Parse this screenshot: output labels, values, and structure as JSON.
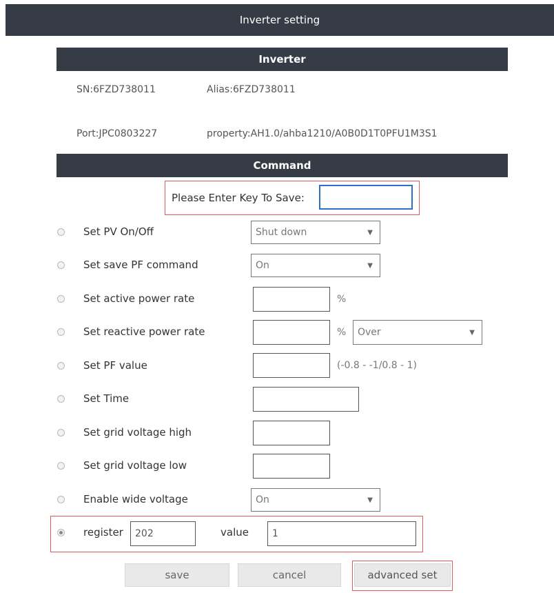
{
  "header": {
    "title": "Inverter setting"
  },
  "inverter_section": {
    "title": "Inverter"
  },
  "info": {
    "sn": "SN:6FZD738011",
    "alias": "Alias:6FZD738011",
    "port": "Port:JPC0803227",
    "property": "property:AH1.0/ahba1210/A0B0D1T0PFU1M3S1"
  },
  "command_section": {
    "title": "Command"
  },
  "key": {
    "label": "Please Enter Key To Save:",
    "value": ""
  },
  "commands": {
    "pv": {
      "label": "Set PV On/Off",
      "selected": "Shut down"
    },
    "save_pf": {
      "label": "Set save PF command",
      "selected": "On"
    },
    "active": {
      "label": "Set active power rate",
      "value": "",
      "unit": "%"
    },
    "reactive": {
      "label": "Set reactive power rate",
      "value": "",
      "unit": "%",
      "mode_selected": "Over"
    },
    "pf_value": {
      "label": "Set PF value",
      "value": "",
      "range": "(-0.8 - -1/0.8 - 1)"
    },
    "time": {
      "label": "Set Time",
      "value": ""
    },
    "grid_high": {
      "label": "Set grid voltage high",
      "value": ""
    },
    "grid_low": {
      "label": "Set grid voltage low",
      "value": ""
    },
    "wide": {
      "label": "Enable wide voltage",
      "selected": "On"
    },
    "register": {
      "label": "register",
      "register_value": "202",
      "value_label": "value",
      "value": "1"
    }
  },
  "buttons": {
    "save": "save",
    "cancel": "cancel",
    "advanced": "advanced set"
  },
  "icons": {
    "dropdown": "chevron-down-icon",
    "radio": "radio-icon"
  },
  "colors": {
    "header_bg": "#353c45",
    "highlight_border": "#e05a5a",
    "key_input_border": "#2a6fc9"
  }
}
